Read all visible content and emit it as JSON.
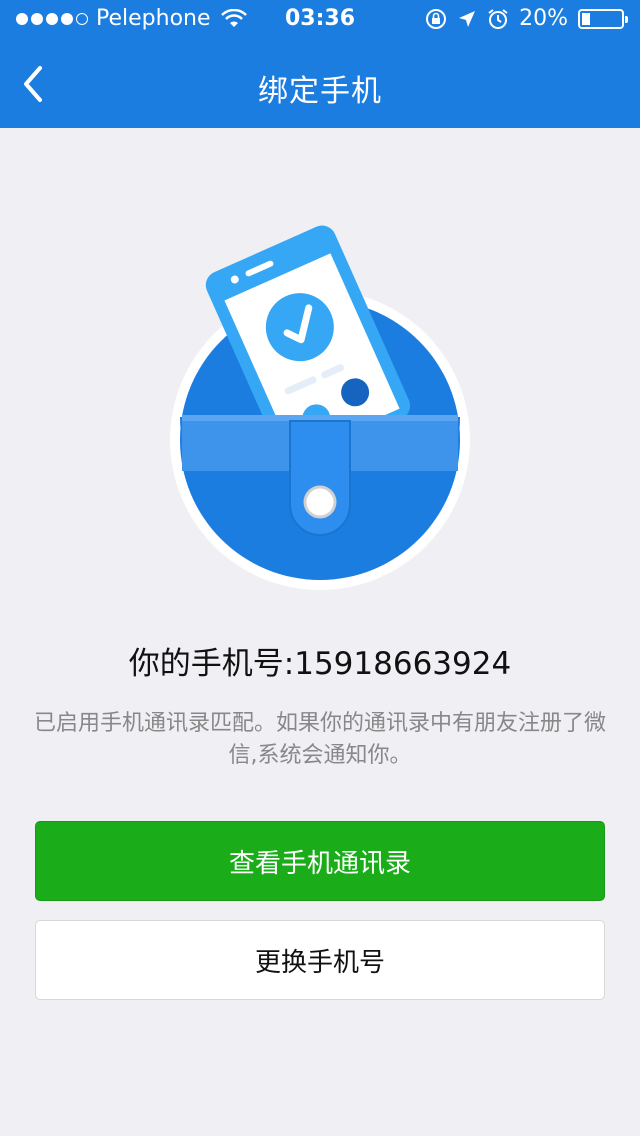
{
  "status_bar": {
    "carrier": "Pelephone",
    "time": "03:36",
    "battery": "20%",
    "battery_level": 0.2
  },
  "navbar": {
    "title": "绑定手机",
    "back_icon": "chevron-left-icon"
  },
  "main": {
    "phone_label": "你的手机号:15918663924",
    "description": "已启用手机通讯录匹配。如果你的通讯录中有朋友注册了微信,系统会通知你。"
  },
  "buttons": {
    "view_contacts": "查看手机通讯录",
    "change_phone": "更换手机号"
  },
  "colors": {
    "header": "#1c7de0",
    "primary_button": "#1aad19",
    "background": "#efeff4"
  }
}
